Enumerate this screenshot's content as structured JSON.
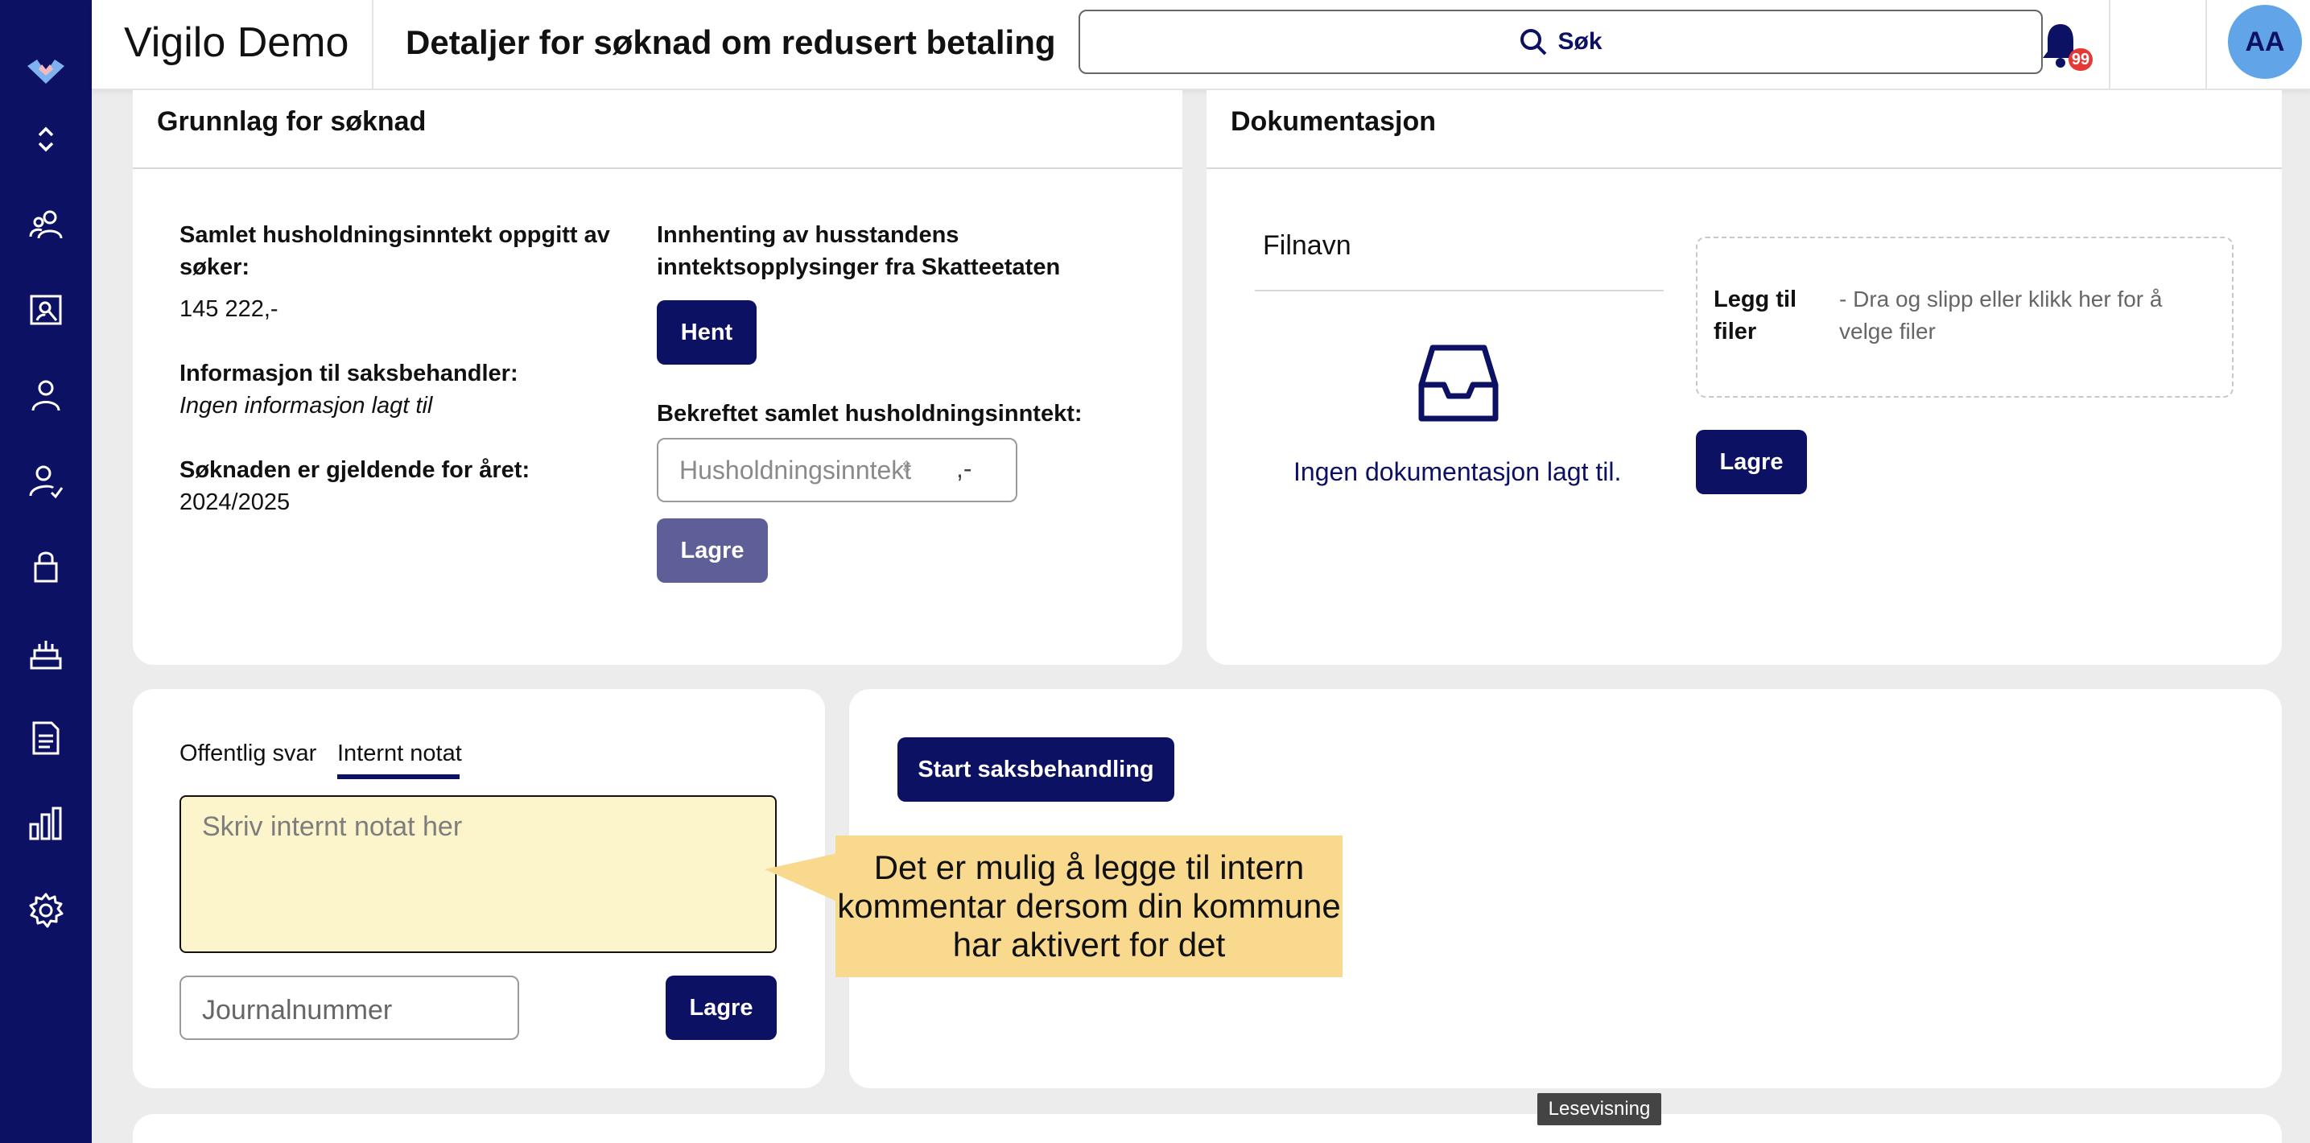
{
  "app": {
    "title": "Vigilo Demo",
    "page_title": "Detaljer for søknad om redusert betaling",
    "brand_color": "#0d1163"
  },
  "search": {
    "label": "Søk"
  },
  "notifications": {
    "count": "99"
  },
  "user": {
    "initials": "AA"
  },
  "sidebar": {
    "items": [
      {
        "icon": "expand-collapse-icon"
      },
      {
        "icon": "people-icon"
      },
      {
        "icon": "search-person-icon"
      },
      {
        "icon": "person-icon"
      },
      {
        "icon": "person-check-icon"
      },
      {
        "icon": "lock-icon"
      },
      {
        "icon": "cake-icon"
      },
      {
        "icon": "document-icon"
      },
      {
        "icon": "bar-chart-icon"
      },
      {
        "icon": "settings-icon"
      }
    ]
  },
  "grunnlag": {
    "title": "Grunnlag for søknad",
    "income_label": "Samlet husholdningsinntekt oppgitt av søker:",
    "income_value": "145 222,-",
    "info_label": "Informasjon til saksbehandler:",
    "info_value": "Ingen informasjon lagt til",
    "year_label": "Søknaden er gjeldende for året:",
    "year_value": "2024/2025",
    "fetch_label": "Innhenting av husstandens inntektsopplysinger fra Skatteetaten",
    "fetch_button": "Hent",
    "confirmed_label": "Bekreftet samlet husholdningsinntekt:",
    "confirmed_placeholder": "Husholdningsinntekt",
    "confirmed_suffix": ",-",
    "save_button": "Lagre"
  },
  "dokumentasjon": {
    "title": "Dokumentasjon",
    "filename_header": "Filnavn",
    "empty_text": "Ingen dokumentasjon lagt til.",
    "dropzone_title": "Legg til filer",
    "dropzone_text": "- Dra og slipp eller klikk her for å velge filer",
    "save_button": "Lagre"
  },
  "notes": {
    "tabs": [
      {
        "label": "Offentlig svar",
        "active": false
      },
      {
        "label": "Internt notat",
        "active": true
      }
    ],
    "note_placeholder": "Skriv internt notat her",
    "journal_placeholder": "Journalnummer",
    "save_button": "Lagre"
  },
  "actions": {
    "start_button": "Start saksbehandling"
  },
  "tooltip": {
    "text": "Det er mulig å legge til intern kommentar dersom din kommune har aktivert for det"
  },
  "footer": {
    "read_mode_label": "Lesevisning"
  }
}
